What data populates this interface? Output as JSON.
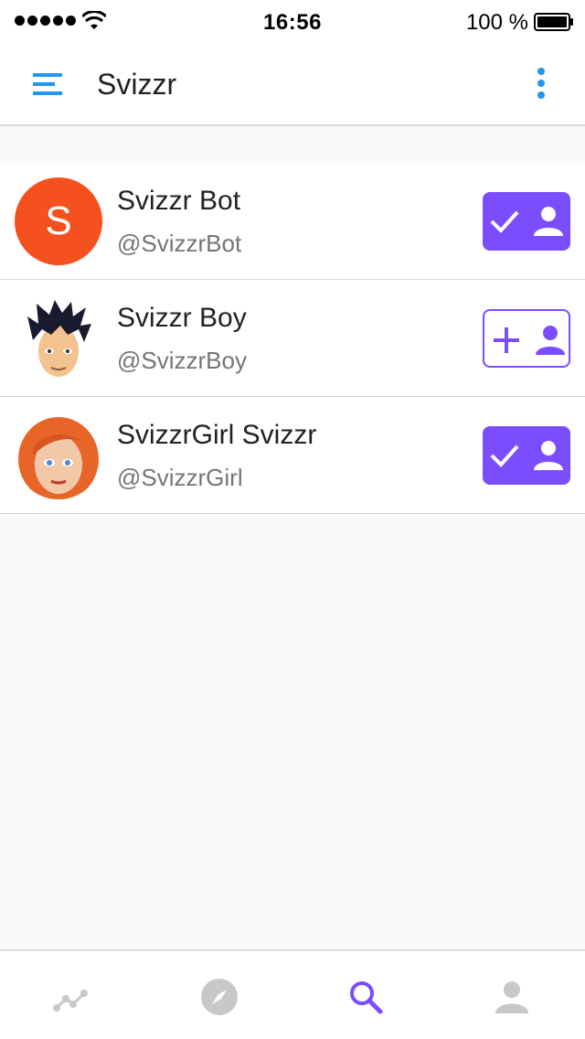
{
  "status_bar": {
    "time": "16:56",
    "battery": "100 %",
    "signal_icon": "signal-dots-icon",
    "wifi_icon": "wifi-icon",
    "battery_icon": "battery-icon"
  },
  "app_bar": {
    "title": "Svizzr",
    "menu_icon": "menu-icon",
    "more_icon": "more-vertical-icon"
  },
  "users": [
    {
      "name": "Svizzr Bot",
      "handle": "@SvizzrBot",
      "avatar_letter": "S",
      "avatar_color": "#f4511e",
      "following": true
    },
    {
      "name": "Svizzr Boy",
      "handle": "@SvizzrBoy",
      "avatar_icon": "cartoon-boy-avatar",
      "following": false
    },
    {
      "name": "SvizzrGirl Svizzr",
      "handle": "@SvizzrGirl",
      "avatar_icon": "cartoon-girl-avatar",
      "following": true
    }
  ],
  "bottom_nav": {
    "tabs": [
      {
        "icon": "activity-icon",
        "active": false
      },
      {
        "icon": "compass-icon",
        "active": false
      },
      {
        "icon": "search-icon",
        "active": true
      },
      {
        "icon": "profile-icon",
        "active": false
      }
    ]
  },
  "colors": {
    "accent": "#7b4dff",
    "primary_blue": "#2196f3",
    "avatar_orange": "#f4511e",
    "inactive_icon": "#c8c8c8"
  }
}
